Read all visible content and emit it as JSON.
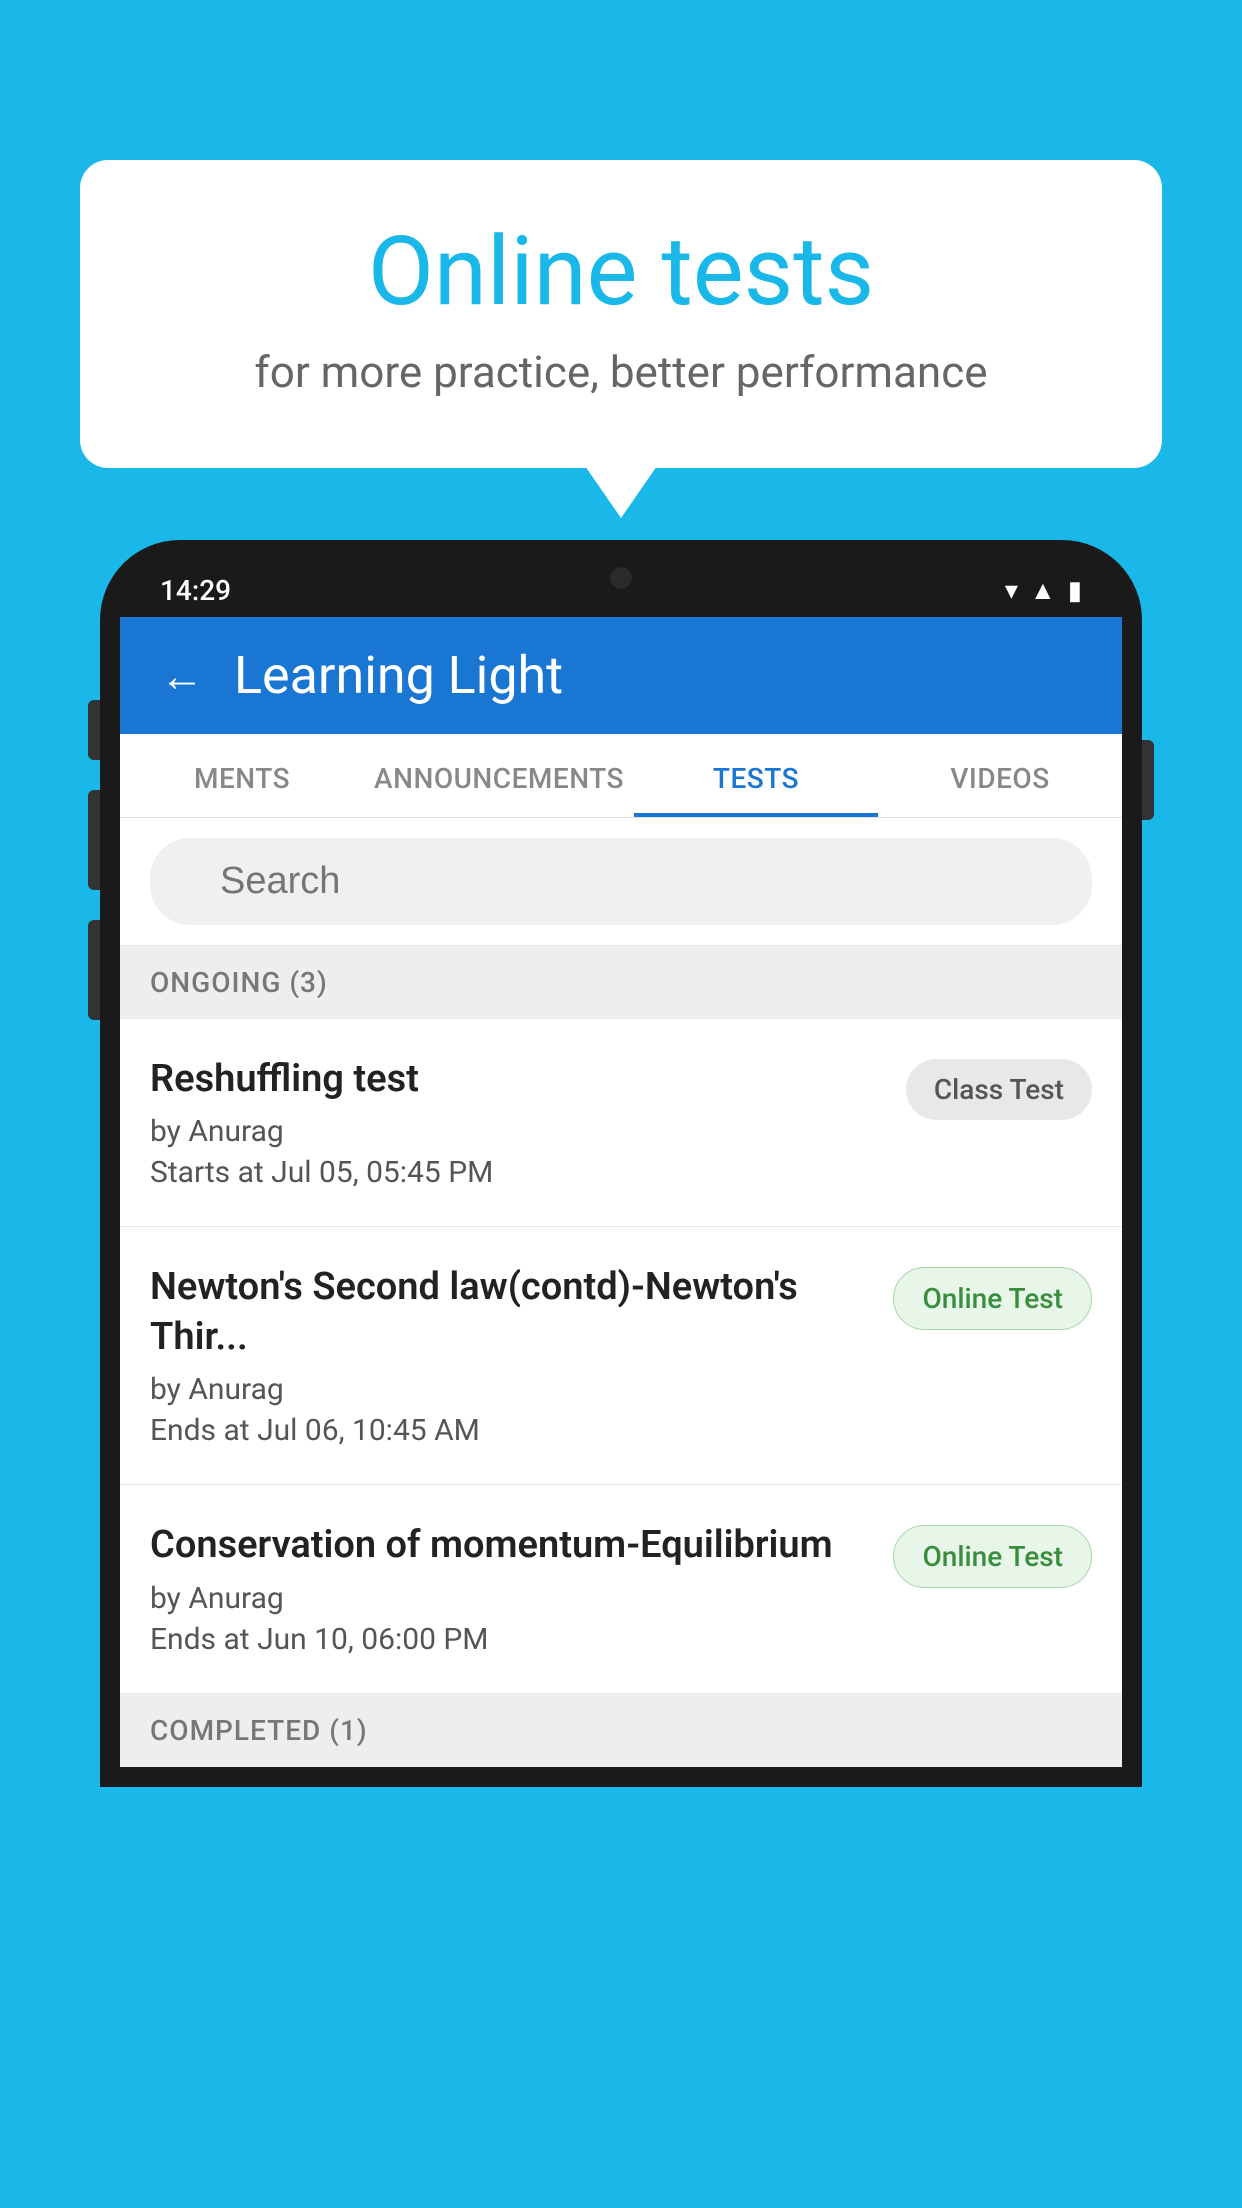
{
  "background_color": "#1ab8e8",
  "speech_bubble": {
    "title": "Online tests",
    "subtitle": "for more practice, better performance"
  },
  "phone": {
    "status_bar": {
      "time": "14:29",
      "icons": [
        "wifi",
        "signal",
        "battery"
      ]
    },
    "app_header": {
      "back_label": "←",
      "title": "Learning Light"
    },
    "tabs": [
      {
        "label": "MENTS",
        "active": false
      },
      {
        "label": "ANNOUNCEMENTS",
        "active": false
      },
      {
        "label": "TESTS",
        "active": true
      },
      {
        "label": "VIDEOS",
        "active": false
      }
    ],
    "search": {
      "placeholder": "Search"
    },
    "ongoing_section": {
      "header": "ONGOING (3)",
      "items": [
        {
          "name": "Reshuffling test",
          "by": "by Anurag",
          "date_label": "Starts at",
          "date": "Jul 05, 05:45 PM",
          "badge": "Class Test",
          "badge_type": "class"
        },
        {
          "name": "Newton's Second law(contd)-Newton's Thir...",
          "by": "by Anurag",
          "date_label": "Ends at",
          "date": "Jul 06, 10:45 AM",
          "badge": "Online Test",
          "badge_type": "online"
        },
        {
          "name": "Conservation of momentum-Equilibrium",
          "by": "by Anurag",
          "date_label": "Ends at",
          "date": "Jun 10, 06:00 PM",
          "badge": "Online Test",
          "badge_type": "online"
        }
      ]
    },
    "completed_section": {
      "header": "COMPLETED (1)"
    }
  }
}
